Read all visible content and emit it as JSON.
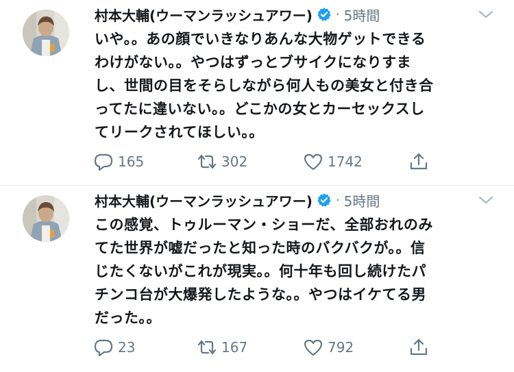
{
  "tweets": [
    {
      "author": "村本大輔(ウーマンラッシュアワー)",
      "separator": "·",
      "time": "5時間",
      "lines": [
        "いや。。あの顔でいきなりあんな大物ゲットできる",
        "わけがない。。やつはずっとブサイクになりすま",
        "し、世間の目をそらしながら何人もの美女と付き合",
        "ってたに違いない。。どこかの女とカーセックスし",
        "てリークされてほしい。。"
      ],
      "replies": "165",
      "retweets": "302",
      "likes": "1742",
      "icons": {
        "reply": "reply-icon",
        "retweet": "retweet-icon",
        "like": "heart-icon",
        "share": "share-icon",
        "verified": "verified-badge-icon",
        "caret": "chevron-down-icon"
      }
    },
    {
      "author": "村本大輔(ウーマンラッシュアワー)",
      "separator": "·",
      "time": "5時間",
      "lines": [
        "この感覚、トゥルーマン・ショーだ、全部おれのみ",
        "てた世界が嘘だったと知った時のバクバクが。。信",
        "じたくないがこれが現実。。何十年も回し続けたパ",
        "チンコ台が大爆発したような。。やつはイケてる男",
        "だった。。"
      ],
      "replies": "23",
      "retweets": "167",
      "likes": "792",
      "icons": {
        "reply": "reply-icon",
        "retweet": "retweet-icon",
        "like": "heart-icon",
        "share": "share-icon",
        "verified": "verified-badge-icon",
        "caret": "chevron-down-icon"
      }
    }
  ],
  "colors": {
    "text": "#14171a",
    "muted": "#657786",
    "verified": "#1da1f2",
    "divider": "#e6ecf0"
  }
}
